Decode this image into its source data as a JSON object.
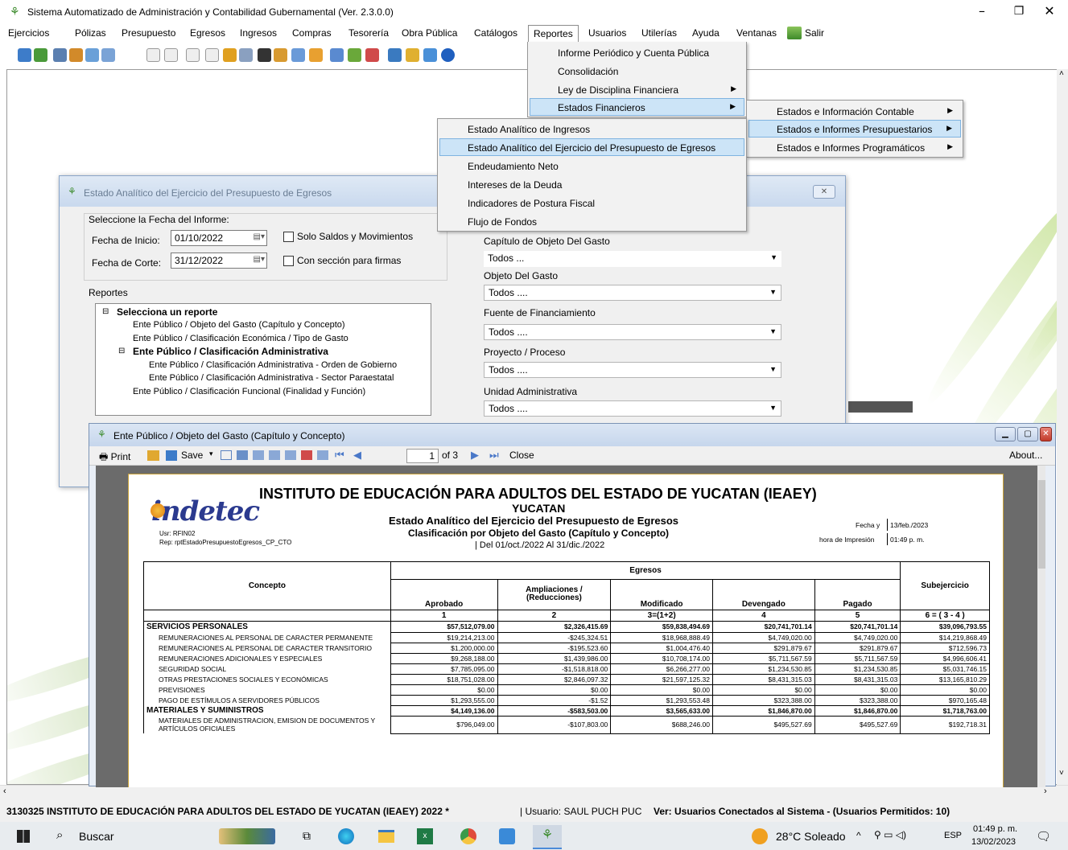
{
  "app": {
    "title": "Sistema Automatizado de Administración y Contabilidad Gubernamental  (Ver. 2.3.0.0)"
  },
  "menubar": [
    "Ejercicios",
    "Pólizas",
    "Presupuesto",
    "Egresos",
    "Ingresos",
    "Compras",
    "Tesorería",
    "Obra Pública",
    "Catálogos",
    "Reportes",
    "Usuarios",
    "Utilerías",
    "Ayuda",
    "Ventanas",
    "Salir"
  ],
  "reportes_menu": [
    "Informe Periódico y Cuenta Pública",
    "Consolidación",
    "Ley de Disciplina Financiera",
    "Estados Financieros"
  ],
  "estados_menu": [
    "Estados e Información Contable",
    "Estados e Informes Presupuestarios",
    "Estados e Informes Programáticos"
  ],
  "presup_menu": [
    "Estado Analítico de Ingresos",
    "Estado Analítico del Ejercicio del Presupuesto de Egresos",
    "Endeudamiento Neto",
    "Intereses de la Deuda",
    "Indicadores de Postura Fiscal",
    "Flujo de Fondos"
  ],
  "dialog": {
    "title": "Estado Analítico del Ejercicio del Presupuesto de Egresos",
    "fecha_group": "Seleccione la Fecha del Informe:",
    "fecha_inicio_label": "Fecha de Inicio:",
    "fecha_inicio": "01/10/2022",
    "fecha_corte_label": "Fecha de Corte:",
    "fecha_corte": "31/12/2022",
    "chk_saldos": "Solo Saldos y Movimientos",
    "chk_firmas": "Con sección para firmas",
    "reportes_label": "Reportes",
    "tree": {
      "root": "Selecciona un reporte",
      "n1": "Ente Público / Objeto del Gasto (Capítulo y Concepto)",
      "n2": "Ente Público / Clasificación Económica / Tipo de Gasto",
      "n3": "Ente Público / Clasificación Administrativa",
      "n3a": "Ente Público / Clasificación Administrativa - Orden de Gobierno",
      "n3b": "Ente Público / Clasificación Administrativa - Sector Paraestatal",
      "n4": "Ente Público / Clasificación Funcional (Finalidad y Función)"
    },
    "filters": [
      {
        "label": "Capítulo de Objeto Del Gasto",
        "value": "Todos ..."
      },
      {
        "label": "Objeto Del Gasto",
        "value": "Todos ...."
      },
      {
        "label": "Fuente de Financiamiento",
        "value": "Todos ...."
      },
      {
        "label": "Proyecto / Proceso",
        "value": "Todos ...."
      },
      {
        "label": "Unidad Administrativa",
        "value": "Todos ...."
      }
    ]
  },
  "report_window": {
    "title": "Ente Público /  Objeto del Gasto (Capítulo y Concepto)",
    "print": "Print",
    "save": "Save",
    "page": "1",
    "of": "of 3",
    "close": "Close",
    "about": "About..."
  },
  "report": {
    "logo": "indetec",
    "institution": "INSTITUTO DE EDUCACIÓN PARA ADULTOS DEL ESTADO DE YUCATAN (IEAEY)",
    "state": "YUCATAN",
    "title": "Estado Analítico del Ejercicio del Presupuesto de Egresos",
    "subtitle": "Clasificación por Objeto del Gasto (Capítulo y Concepto)",
    "period": "| Del 01/oct./2022 Al 31/dic./2022",
    "usr": "Usr: RFIN02",
    "rep": "Rep: rptEstadoPresupuestoEgresos_CP_CTO",
    "fecha_label": "Fecha y",
    "fecha": "13/feb./2023",
    "hora_label": "hora de Impresión",
    "hora": "01:49 p. m.",
    "egresos": "Egresos",
    "concepto": "Concepto",
    "subejercicio": "Subejercicio",
    "cols": [
      "Aprobado",
      "Ampliaciones / (Reducciones)",
      "Modificado",
      "Devengado",
      "Pagado"
    ],
    "colnums": [
      "1",
      "2",
      "3=(1+2)",
      "4",
      "5",
      "6 = ( 3 - 4 )"
    ],
    "rows": [
      {
        "c": "SERVICIOS PERSONALES",
        "v": [
          "$57,512,079.00",
          "$2,326,415.69",
          "$59,838,494.69",
          "$20,741,701.14",
          "$20,741,701.14",
          "$39,096,793.55"
        ],
        "sec": true
      },
      {
        "c": "REMUNERACIONES AL PERSONAL DE CARACTER PERMANENTE",
        "v": [
          "$19,214,213.00",
          "-$245,324.51",
          "$18,968,888.49",
          "$4,749,020.00",
          "$4,749,020.00",
          "$14,219,868.49"
        ]
      },
      {
        "c": "REMUNERACIONES AL PERSONAL DE CARACTER TRANSITORIO",
        "v": [
          "$1,200,000.00",
          "-$195,523.60",
          "$1,004,476.40",
          "$291,879.67",
          "$291,879.67",
          "$712,596.73"
        ]
      },
      {
        "c": "REMUNERACIONES ADICIONALES Y ESPECIALES",
        "v": [
          "$9,268,188.00",
          "$1,439,986.00",
          "$10,708,174.00",
          "$5,711,567.59",
          "$5,711,567.59",
          "$4,996,606.41"
        ]
      },
      {
        "c": "SEGURIDAD SOCIAL",
        "v": [
          "$7,785,095.00",
          "-$1,518,818.00",
          "$6,266,277.00",
          "$1,234,530.85",
          "$1,234,530.85",
          "$5,031,746.15"
        ]
      },
      {
        "c": "OTRAS PRESTACIONES SOCIALES Y ECONÓMICAS",
        "v": [
          "$18,751,028.00",
          "$2,846,097.32",
          "$21,597,125.32",
          "$8,431,315.03",
          "$8,431,315.03",
          "$13,165,810.29"
        ]
      },
      {
        "c": "PREVISIONES",
        "v": [
          "$0.00",
          "$0.00",
          "$0.00",
          "$0.00",
          "$0.00",
          "$0.00"
        ]
      },
      {
        "c": "PAGO DE ESTÍMULOS A SERVIDORES PÚBLICOS",
        "v": [
          "$1,293,555.00",
          "-$1.52",
          "$1,293,553.48",
          "$323,388.00",
          "$323,388.00",
          "$970,165.48"
        ]
      },
      {
        "c": "MATERIALES Y SUMINISTROS",
        "v": [
          "$4,149,136.00",
          "-$583,503.00",
          "$3,565,633.00",
          "$1,846,870.00",
          "$1,846,870.00",
          "$1,718,763.00"
        ],
        "sec": true
      },
      {
        "c": "MATERIALES DE ADMINISTRACION, EMISION DE DOCUMENTOS Y ARTÍCULOS OFICIALES",
        "v": [
          "$796,049.00",
          "-$107,803.00",
          "$688,246.00",
          "$495,527.69",
          "$495,527.69",
          "$192,718.31"
        ]
      }
    ]
  },
  "statusbar": {
    "ente": "3130325 INSTITUTO DE EDUCACIÓN PARA ADULTOS DEL ESTADO DE YUCATAN (IEAEY)  2022  *",
    "usuario": "| Usuario: SAUL PUCH PUC",
    "ver": "Ver: Usuarios Conectados al Sistema - (Usuarios Permitidos: 10)"
  },
  "taskbar": {
    "search": "Buscar",
    "weather": "28°C  Soleado",
    "lang": "ESP",
    "time": "01:49 p. m.",
    "date": "13/02/2023"
  }
}
